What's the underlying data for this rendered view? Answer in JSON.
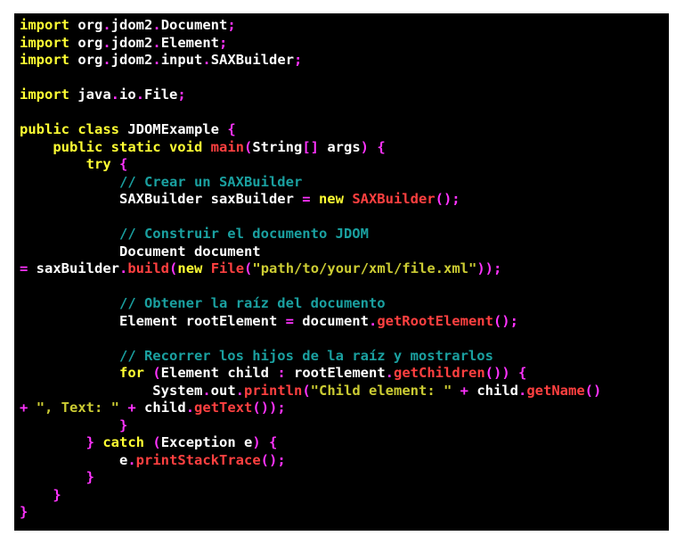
{
  "colors": {
    "background": "#000000",
    "keyword": "#ffff33",
    "plain": "#ffffff",
    "punctuation": "#ff33ff",
    "comment": "#1aa0a0",
    "function": "#ff4040",
    "string": "#cccc33"
  },
  "code_lines": [
    [
      [
        "kw",
        "import"
      ],
      [
        "pl",
        " org"
      ],
      [
        "pu",
        "."
      ],
      [
        "pl",
        "jdom2"
      ],
      [
        "pu",
        "."
      ],
      [
        "pl",
        "Document"
      ],
      [
        "pu",
        ";"
      ]
    ],
    [
      [
        "kw",
        "import"
      ],
      [
        "pl",
        " org"
      ],
      [
        "pu",
        "."
      ],
      [
        "pl",
        "jdom2"
      ],
      [
        "pu",
        "."
      ],
      [
        "pl",
        "Element"
      ],
      [
        "pu",
        ";"
      ]
    ],
    [
      [
        "kw",
        "import"
      ],
      [
        "pl",
        " org"
      ],
      [
        "pu",
        "."
      ],
      [
        "pl",
        "jdom2"
      ],
      [
        "pu",
        "."
      ],
      [
        "pl",
        "input"
      ],
      [
        "pu",
        "."
      ],
      [
        "pl",
        "SAXBuilder"
      ],
      [
        "pu",
        ";"
      ]
    ],
    [],
    [
      [
        "kw",
        "import"
      ],
      [
        "pl",
        " java"
      ],
      [
        "pu",
        "."
      ],
      [
        "pl",
        "io"
      ],
      [
        "pu",
        "."
      ],
      [
        "pl",
        "File"
      ],
      [
        "pu",
        ";"
      ]
    ],
    [],
    [
      [
        "kw",
        "public class"
      ],
      [
        "pl",
        " JDOMExample "
      ],
      [
        "pu",
        "{"
      ]
    ],
    [
      [
        "pl",
        "    "
      ],
      [
        "kw",
        "public static void"
      ],
      [
        "pl",
        " "
      ],
      [
        "fn",
        "main"
      ],
      [
        "pu",
        "("
      ],
      [
        "pl",
        "String"
      ],
      [
        "pu",
        "[]"
      ],
      [
        "pl",
        " args"
      ],
      [
        "pu",
        ")"
      ],
      [
        "pl",
        " "
      ],
      [
        "pu",
        "{"
      ]
    ],
    [
      [
        "pl",
        "        "
      ],
      [
        "kw",
        "try"
      ],
      [
        "pl",
        " "
      ],
      [
        "pu",
        "{"
      ]
    ],
    [
      [
        "pl",
        "            "
      ],
      [
        "cm",
        "// Crear un SAXBuilder"
      ]
    ],
    [
      [
        "pl",
        "            SAXBuilder saxBuilder "
      ],
      [
        "pu",
        "="
      ],
      [
        "pl",
        " "
      ],
      [
        "kw",
        "new"
      ],
      [
        "pl",
        " "
      ],
      [
        "fn",
        "SAXBuilder"
      ],
      [
        "pu",
        "();"
      ]
    ],
    [],
    [
      [
        "pl",
        "            "
      ],
      [
        "cm",
        "// Construir el documento JDOM"
      ]
    ],
    [
      [
        "pl",
        "            Document document"
      ]
    ],
    [
      [
        "pu",
        "="
      ],
      [
        "pl",
        " saxBuilder"
      ],
      [
        "pu",
        "."
      ],
      [
        "fn",
        "build"
      ],
      [
        "pu",
        "("
      ],
      [
        "kw",
        "new"
      ],
      [
        "pl",
        " "
      ],
      [
        "fn",
        "File"
      ],
      [
        "pu",
        "("
      ],
      [
        "st",
        "\"path/to/your/xml/file.xml\""
      ],
      [
        "pu",
        "));"
      ]
    ],
    [],
    [
      [
        "pl",
        "            "
      ],
      [
        "cm",
        "// Obtener la raíz del documento"
      ]
    ],
    [
      [
        "pl",
        "            Element rootElement "
      ],
      [
        "pu",
        "="
      ],
      [
        "pl",
        " document"
      ],
      [
        "pu",
        "."
      ],
      [
        "fn",
        "getRootElement"
      ],
      [
        "pu",
        "();"
      ]
    ],
    [],
    [
      [
        "pl",
        "            "
      ],
      [
        "cm",
        "// Recorrer los hijos de la raíz y mostrarlos"
      ]
    ],
    [
      [
        "pl",
        "            "
      ],
      [
        "kw",
        "for"
      ],
      [
        "pl",
        " "
      ],
      [
        "pu",
        "("
      ],
      [
        "pl",
        "Element child "
      ],
      [
        "pu",
        ":"
      ],
      [
        "pl",
        " rootElement"
      ],
      [
        "pu",
        "."
      ],
      [
        "fn",
        "getChildren"
      ],
      [
        "pu",
        "())"
      ],
      [
        "pl",
        " "
      ],
      [
        "pu",
        "{"
      ]
    ],
    [
      [
        "pl",
        "                System"
      ],
      [
        "pu",
        "."
      ],
      [
        "pl",
        "out"
      ],
      [
        "pu",
        "."
      ],
      [
        "fn",
        "println"
      ],
      [
        "pu",
        "("
      ],
      [
        "st",
        "\"Child element: \""
      ],
      [
        "pl",
        " "
      ],
      [
        "pu",
        "+"
      ],
      [
        "pl",
        " child"
      ],
      [
        "pu",
        "."
      ],
      [
        "fn",
        "getName"
      ],
      [
        "pu",
        "()"
      ]
    ],
    [
      [
        "pu",
        "+"
      ],
      [
        "pl",
        " "
      ],
      [
        "st",
        "\", Text: \""
      ],
      [
        "pl",
        " "
      ],
      [
        "pu",
        "+"
      ],
      [
        "pl",
        " child"
      ],
      [
        "pu",
        "."
      ],
      [
        "fn",
        "getText"
      ],
      [
        "pu",
        "());"
      ]
    ],
    [
      [
        "pl",
        "            "
      ],
      [
        "pu",
        "}"
      ]
    ],
    [
      [
        "pl",
        "        "
      ],
      [
        "pu",
        "}"
      ],
      [
        "pl",
        " "
      ],
      [
        "kw",
        "catch"
      ],
      [
        "pl",
        " "
      ],
      [
        "pu",
        "("
      ],
      [
        "pl",
        "Exception e"
      ],
      [
        "pu",
        ")"
      ],
      [
        "pl",
        " "
      ],
      [
        "pu",
        "{"
      ]
    ],
    [
      [
        "pl",
        "            e"
      ],
      [
        "pu",
        "."
      ],
      [
        "fn",
        "printStackTrace"
      ],
      [
        "pu",
        "();"
      ]
    ],
    [
      [
        "pl",
        "        "
      ],
      [
        "pu",
        "}"
      ]
    ],
    [
      [
        "pl",
        "    "
      ],
      [
        "pu",
        "}"
      ]
    ],
    [
      [
        "pu",
        "}"
      ]
    ]
  ]
}
